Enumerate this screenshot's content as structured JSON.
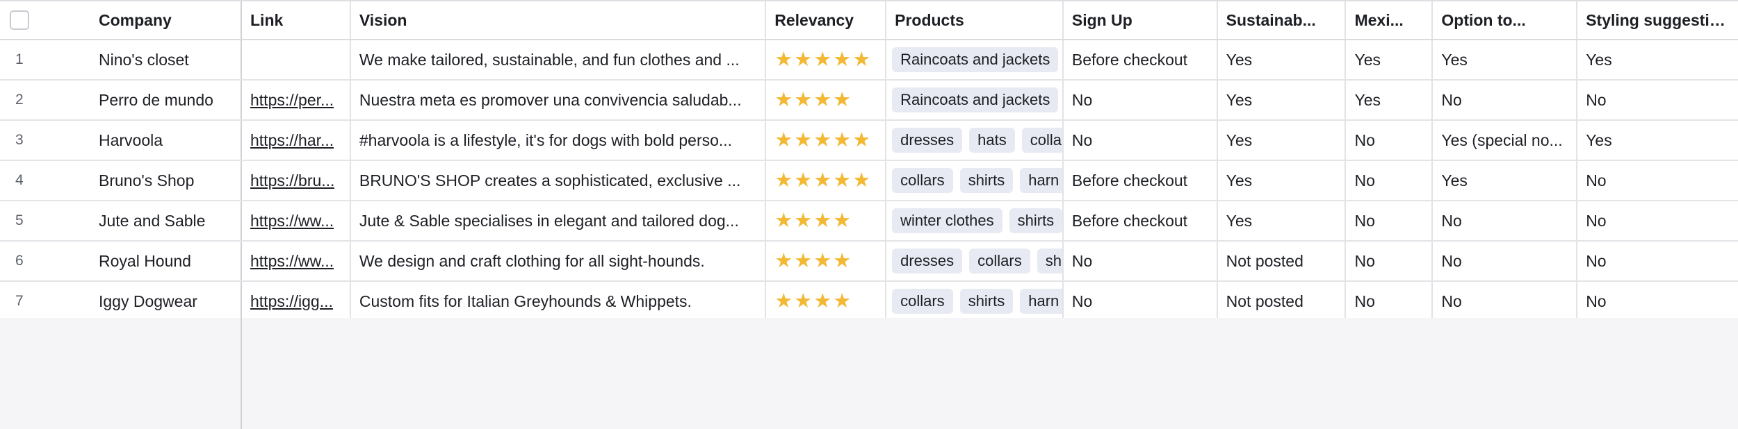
{
  "table": {
    "columns": [
      "Company",
      "Link",
      "Vision",
      "Relevancy",
      "Products",
      "Sign Up",
      "Sustainab...",
      "Mexi...",
      "Option to...",
      "Styling suggestions"
    ],
    "rows": [
      {
        "num": "1",
        "company": "Nino's closet",
        "link": "",
        "vision": "We make tailored, sustainable, and fun clothes and ...",
        "stars": 5,
        "products": [
          "Raincoats and jackets"
        ],
        "signup": "Before checkout",
        "sust": "Yes",
        "mexi": "Yes",
        "option": "Yes",
        "styling": "Yes"
      },
      {
        "num": "2",
        "company": "Perro de mundo",
        "link": "https://per...",
        "vision": "Nuestra meta es promover una convivencia saludab...",
        "stars": 4,
        "products": [
          "Raincoats and jackets"
        ],
        "signup": "No",
        "sust": "Yes",
        "mexi": "Yes",
        "option": "No",
        "styling": "No"
      },
      {
        "num": "3",
        "company": "Harvoola",
        "link": "https://har...",
        "vision": "#harvoola is a lifestyle, it's for dogs with bold perso...",
        "stars": 5,
        "products": [
          "dresses",
          "hats",
          "colla"
        ],
        "signup": "No",
        "sust": "Yes",
        "mexi": "No",
        "option": "Yes (special no...",
        "styling": "Yes"
      },
      {
        "num": "4",
        "company": "Bruno's Shop",
        "link": "https://bru...",
        "vision": "BRUNO'S SHOP creates a sophisticated, exclusive ...",
        "stars": 5,
        "products": [
          "collars",
          "shirts",
          "harn"
        ],
        "signup": "Before checkout",
        "sust": "Yes",
        "mexi": "No",
        "option": "Yes",
        "styling": "No"
      },
      {
        "num": "5",
        "company": "Jute and Sable",
        "link": "https://ww...",
        "vision": "Jute & Sable specialises in elegant and tailored dog...",
        "stars": 4,
        "products": [
          "winter clothes",
          "shirts"
        ],
        "signup": "Before checkout",
        "sust": "Yes",
        "mexi": "No",
        "option": "No",
        "styling": "No"
      },
      {
        "num": "6",
        "company": "Royal Hound",
        "link": "https://ww...",
        "vision": "We design and craft clothing for all sight-hounds.",
        "stars": 4,
        "products": [
          "dresses",
          "collars",
          "sh"
        ],
        "signup": "No",
        "sust": "Not posted",
        "mexi": "No",
        "option": "No",
        "styling": "No"
      },
      {
        "num": "7",
        "company": "Iggy Dogwear",
        "link": "https://igg...",
        "vision": "Custom fits for Italian Greyhounds & Whippets.",
        "stars": 4,
        "products": [
          "collars",
          "shirts",
          "harn"
        ],
        "signup": "No",
        "sust": "Not posted",
        "mexi": "No",
        "option": "No",
        "styling": "No"
      }
    ]
  },
  "colors": {
    "star": "#f3b935",
    "tag_bg": "#e7eaf2",
    "grid_bg": "#ffffff",
    "empty_bg": "#f5f5f8"
  },
  "icons": {
    "rating": "star-icon",
    "select": "checkbox-icon"
  }
}
